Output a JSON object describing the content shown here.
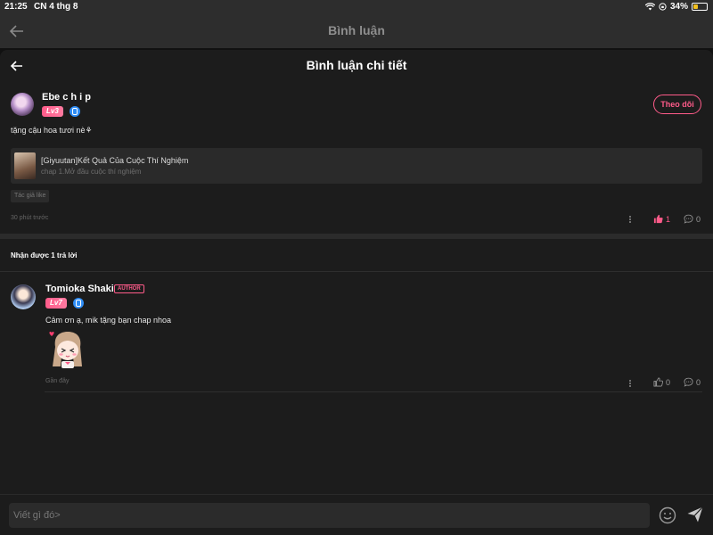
{
  "status_bar": {
    "time": "21:25",
    "date": "CN 4 thg 8",
    "battery": "34%"
  },
  "outer_header": {
    "title": "Bình luận"
  },
  "sheet_header": {
    "title": "Bình luận chi tiết"
  },
  "main_comment": {
    "username": "Ebe c h i p",
    "level": "Lv3",
    "follow_label": "Theo dõi",
    "text": "tặng cậu hoa tươi nè⚘",
    "chapter": {
      "name": "[Giyuutan]Kết Quả Của Cuộc Thí Nghiệm",
      "sub": "chap 1.Mở đầu cuộc thí nghiệm"
    },
    "author_like": "Tác giả like",
    "time": "30 phút trước",
    "likes": "1",
    "replies": "0"
  },
  "replies_header": "Nhận được 1 trả lời",
  "reply": {
    "username": "Tomioka Shaki",
    "author_tag": "AUTHOR",
    "level": "Lv7",
    "text": "Cảm ơn ạ, mik tặng bạn chap nhoa",
    "time": "Gần đây",
    "likes": "0",
    "replies": "0"
  },
  "input": {
    "placeholder": "Viết gì đó>"
  },
  "colors": {
    "accent": "#ff5b8a",
    "background": "#1c1c1c",
    "gender_badge": "#2f8df5"
  }
}
